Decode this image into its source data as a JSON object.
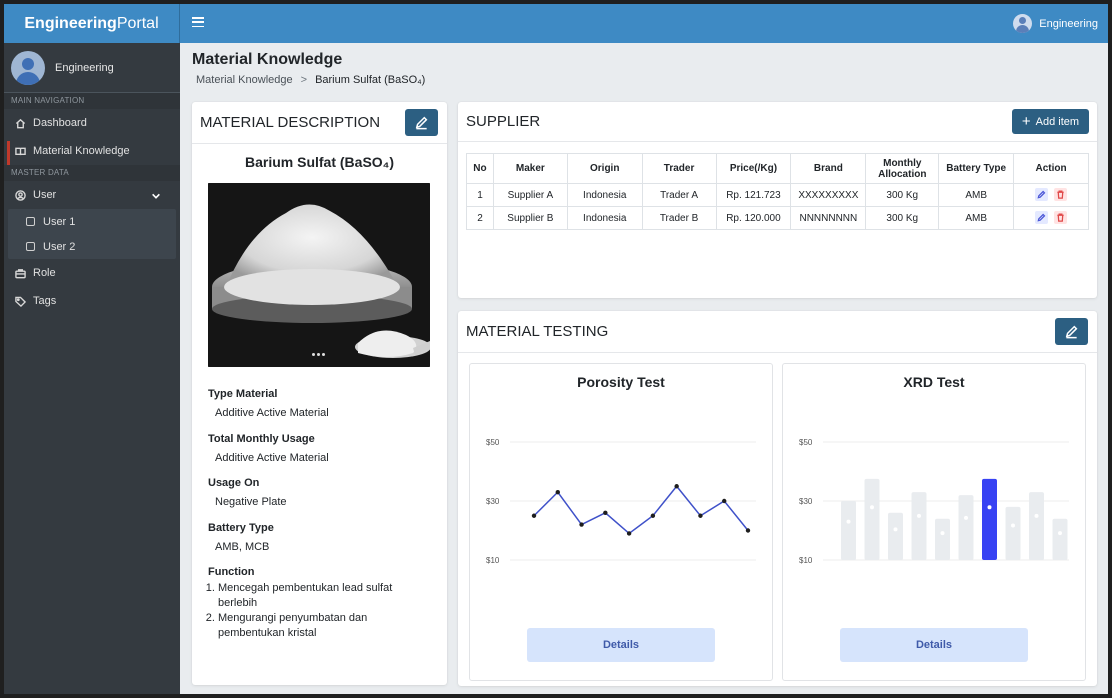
{
  "brand": {
    "bold": "Engineering",
    "light": "Portal"
  },
  "sidebar": {
    "user_name": "Engineering",
    "main_nav_header": "MAIN NAVIGATION",
    "master_data_header": "MASTER DATA",
    "items": [
      {
        "label": "Dashboard",
        "icon": "home-icon"
      },
      {
        "label": "Material Knowledge",
        "icon": "book-icon",
        "active": true
      },
      {
        "label": "User",
        "icon": "user-circle-icon",
        "expanded": true
      },
      {
        "label": "Role",
        "icon": "briefcase-icon"
      },
      {
        "label": "Tags",
        "icon": "tag-icon"
      }
    ],
    "user_sub": [
      "User 1",
      "User 2"
    ]
  },
  "topbar": {
    "user_label": "Engineering"
  },
  "page": {
    "title": "Material Knowledge",
    "breadcrumb": [
      "Material Knowledge",
      "Barium Sulfat (BaSO₄)"
    ]
  },
  "description": {
    "header": "MATERIAL DESCRIPTION",
    "material_name": "Barium Sulfat (BaSO₄)",
    "type_label": "Type Material",
    "type_value": "Additive Active Material",
    "usage_label": "Total Monthly Usage",
    "usage_value": "Additive Active Material",
    "usage_on_label": "Usage On",
    "usage_on_value": "Negative Plate",
    "battery_label": "Battery Type",
    "battery_value": "AMB, MCB",
    "function_label": "Function",
    "functions": [
      "Mencegah pembentukan lead sulfat berlebih",
      "Mengurangi penyumbatan dan pembentukan kristal"
    ]
  },
  "supplier": {
    "header": "SUPPLIER",
    "add_label": "Add item",
    "columns": [
      "No",
      "Maker",
      "Origin",
      "Trader",
      "Price(/Kg)",
      "Brand",
      "Monthly Allocation",
      "Battery Type",
      "Action"
    ],
    "rows": [
      [
        "1",
        "Supplier A",
        "Indonesia",
        "Trader A",
        "Rp. 121.723",
        "XXXXXXXXX",
        "300 Kg",
        "AMB"
      ],
      [
        "2",
        "Supplier B",
        "Indonesia",
        "Trader B",
        "Rp. 120.000",
        "NNNNNNNN",
        "300 Kg",
        "AMB"
      ]
    ]
  },
  "testing": {
    "header": "MATERIAL TESTING",
    "details_label": "Details",
    "porosity": {
      "title": "Porosity Test",
      "chart_data": {
        "type": "line",
        "y_ticks": [
          "$50",
          "$30",
          "$10"
        ],
        "ylim": [
          10,
          50
        ],
        "values": [
          25,
          33,
          22,
          26,
          19,
          25,
          35,
          25,
          30,
          20
        ]
      }
    },
    "xrd": {
      "title": "XRD Test",
      "chart_data": {
        "type": "bar",
        "y_ticks": [
          "$50",
          "$30",
          "$10"
        ],
        "ylim": [
          10,
          50
        ],
        "values": [
          30,
          37.5,
          26,
          33,
          24,
          32,
          37.5,
          28,
          33,
          24
        ],
        "highlight_index": 6,
        "colors": {
          "bar": "#e9ecef",
          "highlight": "#3742f3"
        }
      }
    }
  },
  "colors": {
    "brand": "#3e8ac4",
    "sidebar": "#343a40",
    "button": "#2c5f82"
  }
}
